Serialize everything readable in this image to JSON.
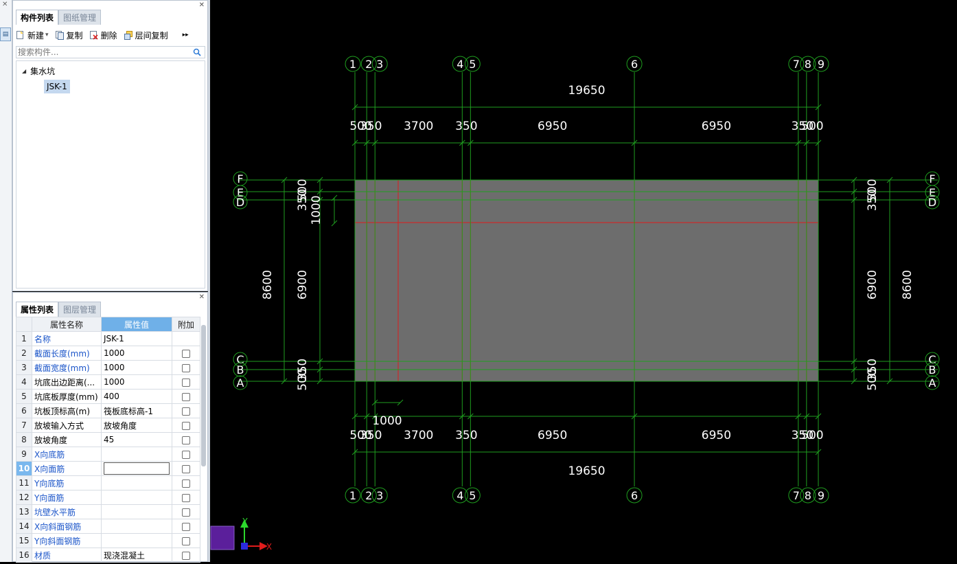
{
  "top_panel": {
    "tabs": [
      "构件列表",
      "图纸管理"
    ],
    "toolbar": {
      "new": "新建",
      "copy": "复制",
      "delete": "删除",
      "floor_copy": "层间复制"
    },
    "search_placeholder": "搜索构件...",
    "tree": {
      "root": "集水坑",
      "child": "JSK-1"
    }
  },
  "bottom_panel": {
    "tabs": [
      "属性列表",
      "图层管理"
    ],
    "headers": {
      "name": "属性名称",
      "value": "属性值",
      "extra": "附加"
    },
    "rows": [
      {
        "num": "1",
        "name": "名称",
        "value": "JSK-1",
        "blue": true,
        "check": false
      },
      {
        "num": "2",
        "name": "截面长度(mm)",
        "value": "1000",
        "blue": true,
        "check": true
      },
      {
        "num": "3",
        "name": "截面宽度(mm)",
        "value": "1000",
        "blue": true,
        "check": true
      },
      {
        "num": "4",
        "name": "坑底出边距离(...",
        "value": "1000",
        "blue": false,
        "check": true
      },
      {
        "num": "5",
        "name": "坑底板厚度(mm)",
        "value": "400",
        "blue": false,
        "check": true
      },
      {
        "num": "6",
        "name": "坑板顶标高(m)",
        "value": "筏板底标高-1",
        "blue": false,
        "check": true
      },
      {
        "num": "7",
        "name": "放坡输入方式",
        "value": "放坡角度",
        "blue": false,
        "check": true
      },
      {
        "num": "8",
        "name": "放坡角度",
        "value": "45",
        "blue": false,
        "check": true
      },
      {
        "num": "9",
        "name": "X向底筋",
        "value": "",
        "blue": true,
        "check": true
      },
      {
        "num": "10",
        "name": "X向面筋",
        "value": "",
        "blue": true,
        "check": true,
        "editing": true
      },
      {
        "num": "11",
        "name": "Y向底筋",
        "value": "",
        "blue": true,
        "check": true
      },
      {
        "num": "12",
        "name": "Y向面筋",
        "value": "",
        "blue": true,
        "check": true
      },
      {
        "num": "13",
        "name": "坑壁水平筋",
        "value": "",
        "blue": true,
        "check": true
      },
      {
        "num": "14",
        "name": "X向斜面钢筋",
        "value": "",
        "blue": true,
        "check": true
      },
      {
        "num": "15",
        "name": "Y向斜面钢筋",
        "value": "",
        "blue": true,
        "check": true
      },
      {
        "num": "16",
        "name": "材质",
        "value": "现浇混凝土",
        "blue": true,
        "check": true
      }
    ]
  },
  "cad": {
    "axes_x": [
      "1",
      "2",
      "3",
      "4",
      "5",
      "6",
      "7",
      "8",
      "9"
    ],
    "axes_y": [
      "F",
      "E",
      "D",
      "C",
      "B",
      "A"
    ],
    "dims_top_total": "19650",
    "dims_top": [
      "500",
      "350",
      "3700",
      "350",
      "6950",
      "6950",
      "350",
      "500"
    ],
    "dims_bottom_total": "19650",
    "dims_bottom": [
      "500",
      "350",
      "3700",
      "350",
      "6950",
      "6950",
      "350",
      "500"
    ],
    "dims_left_total": "8600",
    "dims_left": [
      "500",
      "350",
      "6900",
      "350",
      "500"
    ],
    "dims_right_total": "8600",
    "dims_right": [
      "500",
      "350",
      "6900",
      "350",
      "500"
    ],
    "extra_dim_left": "1000",
    "extra_dim_bottom": "1000",
    "ucs": {
      "x": "X",
      "y": "Y"
    },
    "colors": {
      "grid": "#1f9e1f",
      "slab": "#6d6d6d",
      "edge": "#e01c1c",
      "text": "#ffffff"
    }
  }
}
